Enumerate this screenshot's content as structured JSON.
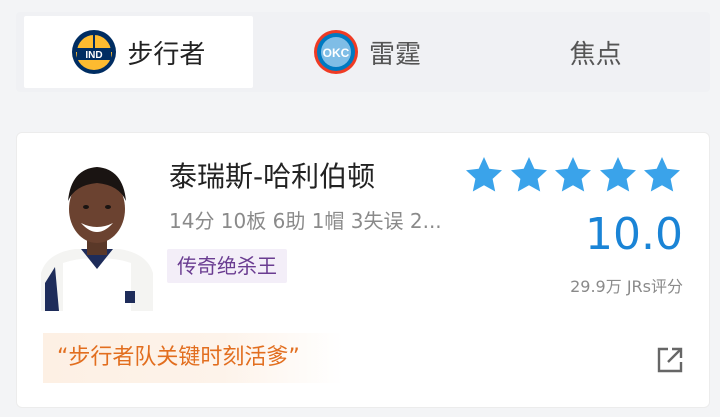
{
  "tabs": [
    {
      "label": "步行者",
      "logo_text": "IND",
      "active": true
    },
    {
      "label": "雷霆",
      "logo_text": "OKC",
      "active": false
    },
    {
      "label": "焦点",
      "active": false
    }
  ],
  "player": {
    "name": "泰瑞斯-哈利伯顿",
    "stats": "14分 10板 6助 1帽 3失误 2...",
    "tag": "传奇绝杀王",
    "rating": "10.0",
    "stars": 5,
    "votes": "29.9万 JRs评分",
    "quote": "“步行者队关键时刻活爹”"
  },
  "colors": {
    "accent": "#1a84d6",
    "star": "#3aa3ea",
    "tag_bg": "#f3eef8",
    "tag_text": "#6a3c91",
    "quote_text": "#e26e1f"
  }
}
